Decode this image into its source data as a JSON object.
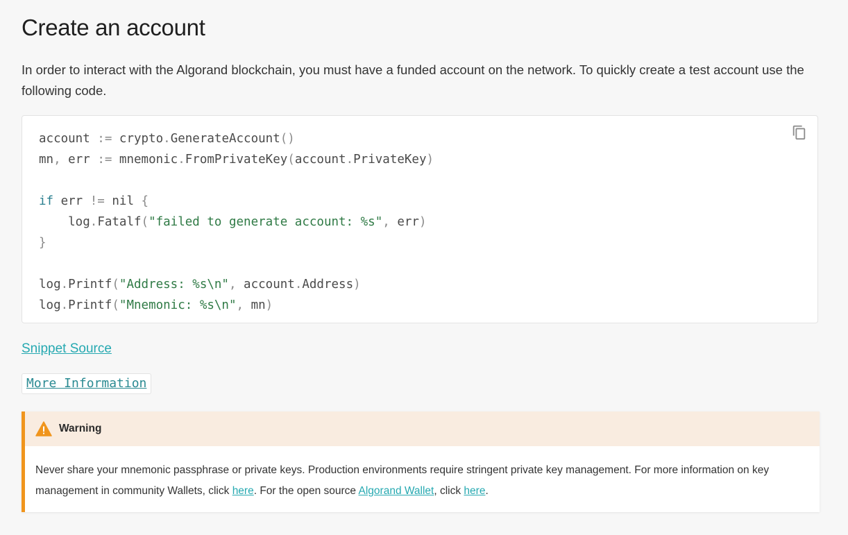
{
  "heading": "Create an account",
  "intro": "In order to interact with the Algorand blockchain, you must have a funded account on the network. To quickly create a test account use the following code.",
  "code": {
    "line1": {
      "a": "account ",
      "b": ":=",
      "c": " crypto",
      "d": ".",
      "e": "GenerateAccount",
      "f": "()"
    },
    "line2": {
      "a": "mn",
      "b": ",",
      "c": " err ",
      "d": ":=",
      "e": " mnemonic",
      "f": ".",
      "g": "FromPrivateKey",
      "h": "(",
      "i": "account",
      "j": ".",
      "k": "PrivateKey",
      "l": ")"
    },
    "line4": {
      "a": "if",
      "b": " err ",
      "c": "!=",
      "d": " nil ",
      "e": "{"
    },
    "line5": {
      "a": "    log",
      "b": ".",
      "c": "Fatalf",
      "d": "(",
      "e": "\"failed to generate account: %s\"",
      "f": ",",
      "g": " err",
      "h": ")"
    },
    "line6": {
      "a": "}"
    },
    "line8": {
      "a": "log",
      "b": ".",
      "c": "Printf",
      "d": "(",
      "e": "\"Address: %s\\n\"",
      "f": ",",
      "g": " account",
      "h": ".",
      "i": "Address",
      "j": ")"
    },
    "line9": {
      "a": "log",
      "b": ".",
      "c": "Printf",
      "d": "(",
      "e": "\"Mnemonic: %s\\n\"",
      "f": ",",
      "g": " mn",
      "h": ")"
    },
    "copy_icon": "copy-icon"
  },
  "links": {
    "snippet_source": "Snippet Source",
    "more_information": "More Information"
  },
  "warning": {
    "title": "Warning",
    "icon": "warning-triangle-icon",
    "accent_color": "#f0951d",
    "text1": "Never share your mnemonic passphrase or private keys. Production environments require stringent private key management. For more information on key management in community Wallets, click ",
    "link1": "here",
    "text2": ". For the open source ",
    "link2": "Algorand Wallet",
    "text3": ", click ",
    "link3": "here",
    "text4": "."
  },
  "colors": {
    "link": "#26a9b1",
    "keyword": "#2a7f8f",
    "string": "#2f7a45"
  }
}
